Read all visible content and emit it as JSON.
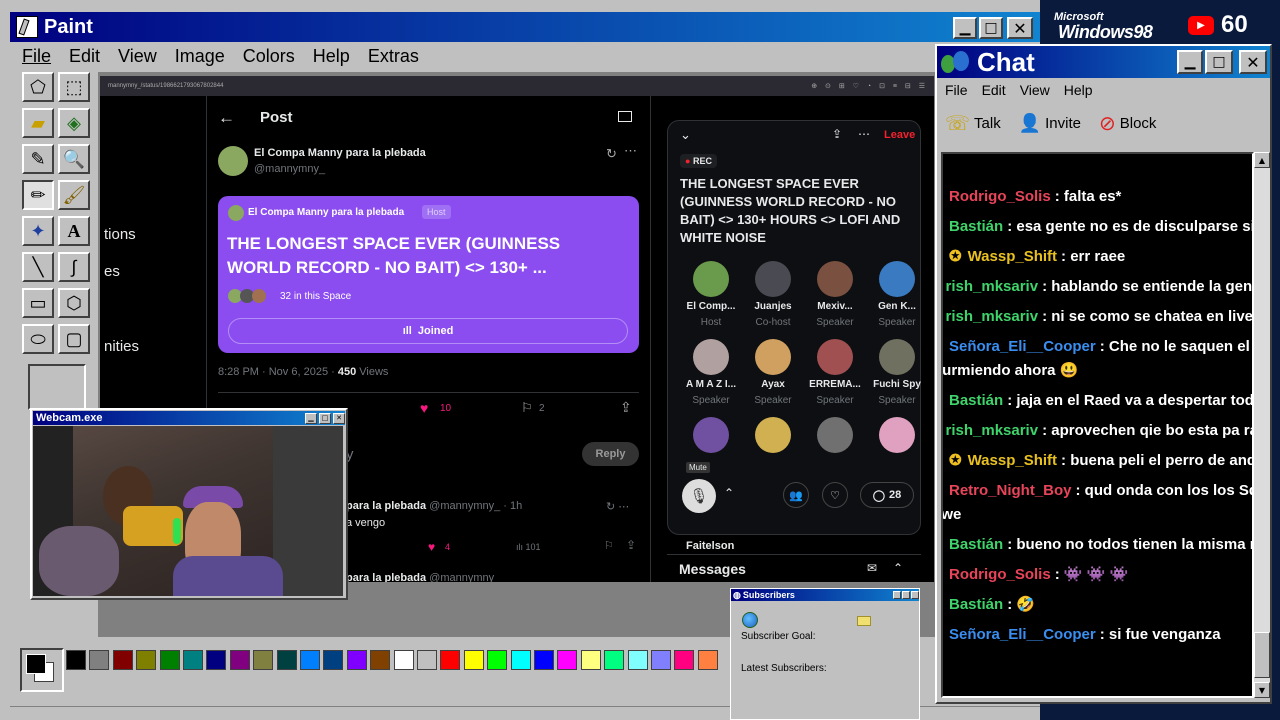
{
  "paint": {
    "title": "Paint",
    "menu": [
      "File",
      "Edit",
      "View",
      "Image",
      "Colors",
      "Help",
      "Extras"
    ]
  },
  "branding": {
    "ms": "Microsoft",
    "win": "Windows98",
    "viewers": "60"
  },
  "browser": {
    "url": "mannymny_/status/1986621793067802844"
  },
  "side_nav": [
    "tions",
    "es",
    "nities"
  ],
  "post": {
    "back": "←",
    "heading": "Post",
    "author": "El Compa Manny para la plebada",
    "handle": "@mannymny_",
    "card_host": "El Compa Manny para la plebada",
    "card_badge": "Host",
    "card_title": "THE LONGEST SPACE EVER (GUINNESS WORLD RECORD - NO BAIT) <> 130+ ...",
    "card_count": "32 in this Space",
    "joined": "Joined",
    "time": "8:28 PM · Nov 6, 2025 · ",
    "views_num": "450",
    "views_lbl": " Views",
    "likes": "10",
    "bookmarks": "2",
    "reply_btn": "Reply",
    "reply_placeholder": "y",
    "reply1_author": "para la plebada",
    "reply1_handle": "@mannymny_ · 1h",
    "reply1_text": "a vengo",
    "reply1_likes": "4",
    "reply1_views": "101",
    "reply2_author": "para la plebada",
    "reply2_handle": "@mannymny"
  },
  "space": {
    "leave": "Leave",
    "rec": "REC",
    "title": "THE LONGEST SPACE EVER (GUINNESS WORLD RECORD - NO BAIT) <> 130+ HOURS <> LOFI AND WHITE NOISE",
    "speakers": [
      {
        "name": "El Comp...",
        "role": "Host",
        "color": "#6a9a4c"
      },
      {
        "name": "Juanjes",
        "role": "Co-host",
        "color": "#4a4a52"
      },
      {
        "name": "Mexiv...",
        "role": "Speaker",
        "color": "#7a5040"
      },
      {
        "name": "Gen K...",
        "role": "Speaker",
        "color": "#3a7ac0"
      },
      {
        "name": "A M A Z I...",
        "role": "Speaker",
        "color": "#b0a0a0"
      },
      {
        "name": "Ayax",
        "role": "Speaker",
        "color": "#d0a060"
      },
      {
        "name": "ERREMA...",
        "role": "Speaker",
        "color": "#a05050"
      },
      {
        "name": "Fuchi Spy",
        "role": "Speaker",
        "color": "#707060"
      },
      {
        "name": "",
        "role": "",
        "color": "#7050a0"
      },
      {
        "name": "",
        "role": "",
        "color": "#d0b050"
      },
      {
        "name": "",
        "role": "",
        "color": "#707070"
      },
      {
        "name": "",
        "role": "",
        "color": "#e0a0c0"
      }
    ],
    "mute": "Mute",
    "comments": "28",
    "below": "Faitelson",
    "messages": "Messages"
  },
  "webcam": {
    "title": "Webcam.exe"
  },
  "chat": {
    "title": "Chat",
    "menu": [
      "File",
      "Edit",
      "View",
      "Help"
    ],
    "talk": "Talk",
    "invite": "Invite",
    "block": "Block",
    "messages": [
      {
        "user": "Rodrigo_Solis",
        "color": "#e8445a",
        "text": ": falta es*",
        "badge": ""
      },
      {
        "user": "Bastián",
        "color": "#3fd36b",
        "text": ": esa gente no es de disculparse si",
        "badge": ""
      },
      {
        "user": "Wassp_Shift",
        "color": "#e8c020",
        "text": ": err raee",
        "badge": "star"
      },
      {
        "user": "rish_mksariv",
        "color": "#3fd36b",
        "text": ": hablando se entiende la gente o",
        "badge": "k"
      },
      {
        "user": "rish_mksariv",
        "color": "#3fd36b",
        "text": ": ni se como se chatea en lives de",
        "badge": "k"
      },
      {
        "user": "Señora_Eli__Cooper",
        "color": "#3a8ef0",
        "text": ": Che no le saquen el cuer",
        "badge": ""
      },
      {
        "user": "",
        "color": "#ffffff",
        "text": "durmiendo ahora 😃",
        "badge": "cont"
      },
      {
        "user": "Bastián",
        "color": "#3fd36b",
        "text": ": jaja en el Raed va a despertar todo en",
        "badge": ""
      },
      {
        "user": "rish_mksariv",
        "color": "#3fd36b",
        "text": ": aprovechen qie bo esta pa rajar",
        "badge": "k"
      },
      {
        "user": "Wassp_Shift",
        "color": "#e8c020",
        "text": ": buena peli el perro de andaluz",
        "badge": "star"
      },
      {
        "user": "Retro_Night_Boy",
        "color": "#e8445a",
        "text": ": qud onda con los los Squid",
        "badge": ""
      },
      {
        "user": "",
        "color": "#ffffff",
        "text": "ewe",
        "badge": "cont"
      },
      {
        "user": "Bastián",
        "color": "#3fd36b",
        "text": ": bueno no todos tienen la misma reac",
        "badge": ""
      },
      {
        "user": "Rodrigo_Solis",
        "color": "#e8445a",
        "text": ": 👾 👾 👾",
        "badge": ""
      },
      {
        "user": "Bastián",
        "color": "#3fd36b",
        "text": ": 🤣",
        "badge": ""
      },
      {
        "user": "Señora_Eli__Cooper",
        "color": "#3a8ef0",
        "text": ": si fue venganza",
        "badge": ""
      }
    ]
  },
  "subs": {
    "title": "Subscribers",
    "goal": "Subscriber Goal:",
    "latest": "Latest Subscribers:"
  },
  "palette": [
    "#000000",
    "#808080",
    "#800000",
    "#808000",
    "#008000",
    "#008080",
    "#000080",
    "#800080",
    "#808040",
    "#004040",
    "#0080ff",
    "#004080",
    "#8000ff",
    "#804000",
    "#ffffff",
    "#c0c0c0",
    "#ff0000",
    "#ffff00",
    "#00ff00",
    "#00ffff",
    "#0000ff",
    "#ff00ff",
    "#ffff80",
    "#00ff80",
    "#80ffff",
    "#8080ff",
    "#ff0080",
    "#ff8040"
  ]
}
